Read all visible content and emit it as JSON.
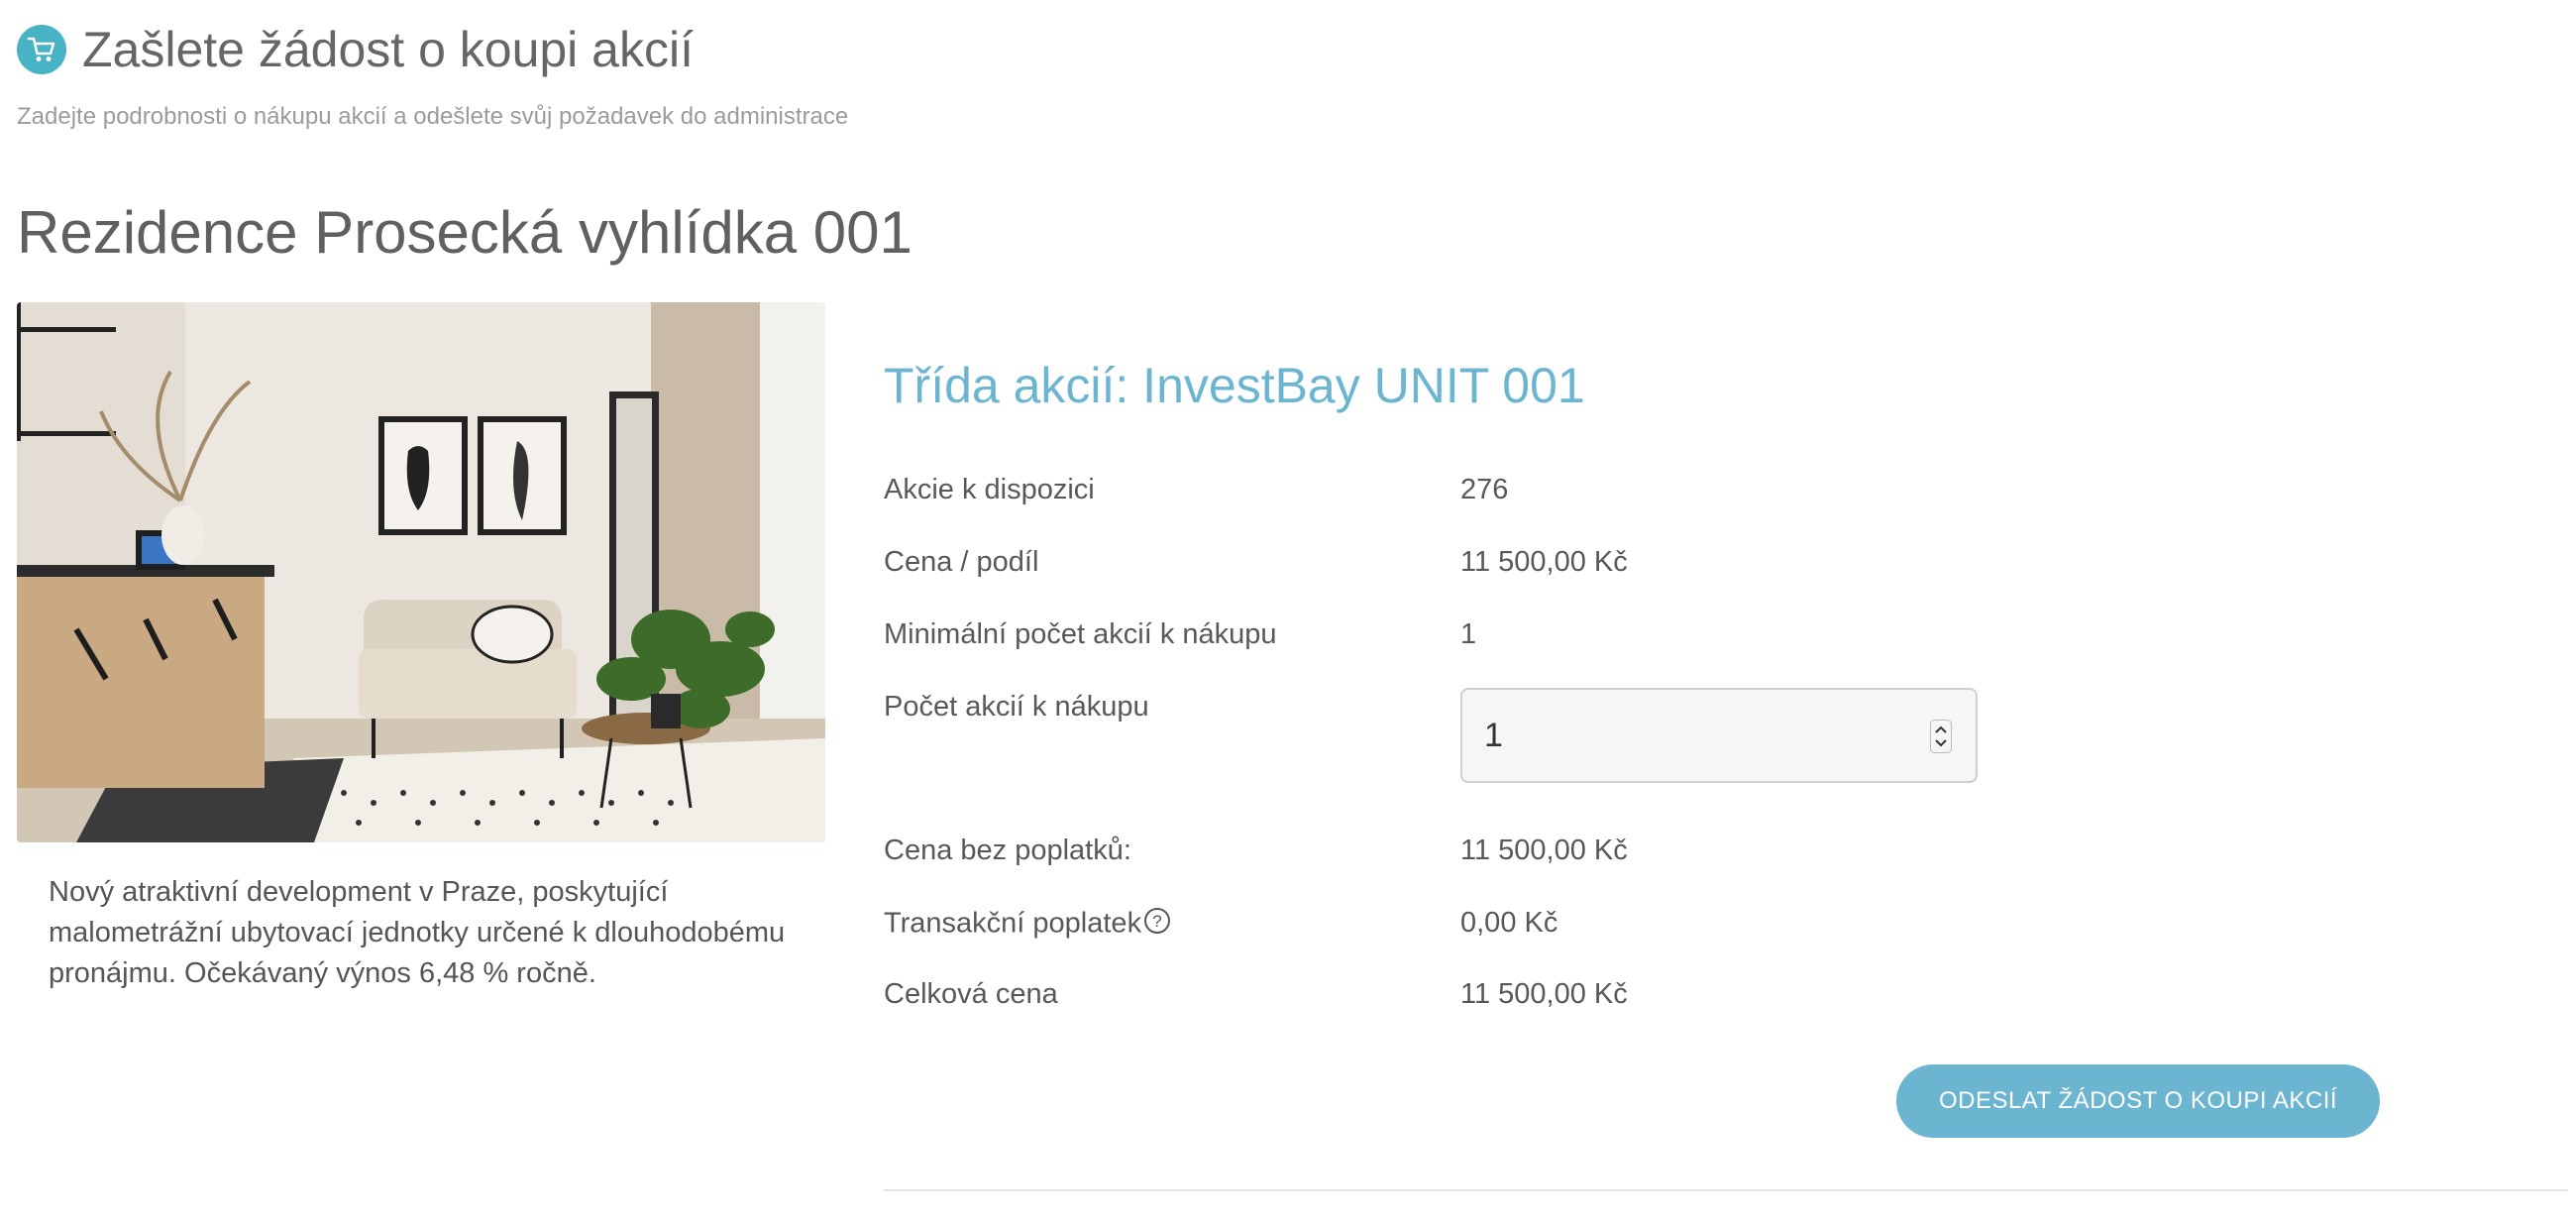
{
  "header": {
    "title": "Zašlete žádost o koupi akcií",
    "subtitle": "Zadejte podrobnosti o nákupu akcií a odešlete svůj požadavek do administrace",
    "icon": "cart-icon",
    "accent_color": "#47b3c4"
  },
  "property": {
    "title": "Rezidence Prosecká vyhlídka 001",
    "image_icon": "living-room-photo",
    "description": "Nový atraktivní development v Praze, poskytující malometrážní ubytovací jednotky určené k dlouhodobému pronájmu. Očekávaný výnos 6,48 % ročně."
  },
  "share_class": {
    "title": "Třída akcií: InvestBay UNIT 001",
    "title_color": "#6bb5d1",
    "available_label": "Akcie k dispozici",
    "available_value": "276",
    "price_label": "Cena / podíl",
    "price_value": "11 500,00 Kč",
    "min_label": "Minimální počet akcií k nákupu",
    "min_value": "1",
    "quantity_label": "Počet akcií k nákupu",
    "quantity_value": "1",
    "price_no_fees_label": "Cena bez poplatků:",
    "price_no_fees_value": "11 500,00 Kč",
    "fee_label": "Transakční poplatek",
    "fee_value": "0,00 Kč",
    "total_label": "Celková cena",
    "total_value": "11 500,00 Kč"
  },
  "actions": {
    "submit_label": "ODESLAT ŽÁDOST O KOUPI AKCIÍ",
    "button_color": "#6bb5d1"
  }
}
